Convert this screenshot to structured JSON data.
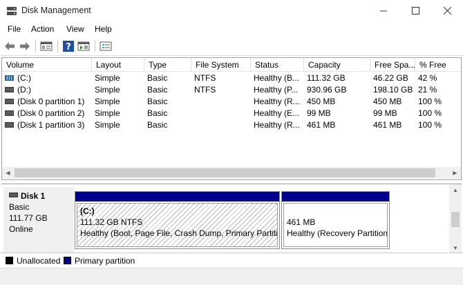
{
  "window": {
    "title": "Disk Management",
    "controls": {
      "minimize": "—",
      "maximize": "☐",
      "close": "✕"
    }
  },
  "menu": [
    "File",
    "Action",
    "View",
    "Help"
  ],
  "toolbar": {
    "buttons": [
      "back-arrow-icon",
      "forward-arrow-icon",
      "properties-icon",
      "help-icon",
      "console-icon",
      "volume-list-icon"
    ]
  },
  "volume_table": {
    "columns": [
      "Volume",
      "Layout",
      "Type",
      "File System",
      "Status",
      "Capacity",
      "Free Spa...",
      "% Free"
    ],
    "rows": [
      {
        "volume": "(C:)",
        "layout": "Simple",
        "type": "Basic",
        "fs": "NTFS",
        "status": "Healthy (B...",
        "capacity": "111.32 GB",
        "free": "46.22 GB",
        "pct": "42 %",
        "icon": "striped"
      },
      {
        "volume": "(D:)",
        "layout": "Simple",
        "type": "Basic",
        "fs": "NTFS",
        "status": "Healthy (P...",
        "capacity": "930.96 GB",
        "free": "198.10 GB",
        "pct": "21 %",
        "icon": "solid"
      },
      {
        "volume": "(Disk 0 partition 1)",
        "layout": "Simple",
        "type": "Basic",
        "fs": "",
        "status": "Healthy (R...",
        "capacity": "450 MB",
        "free": "450 MB",
        "pct": "100 %",
        "icon": "solid"
      },
      {
        "volume": "(Disk 0 partition 2)",
        "layout": "Simple",
        "type": "Basic",
        "fs": "",
        "status": "Healthy (E...",
        "capacity": "99 MB",
        "free": "99 MB",
        "pct": "100 %",
        "icon": "solid"
      },
      {
        "volume": "(Disk 1 partition 3)",
        "layout": "Simple",
        "type": "Basic",
        "fs": "",
        "status": "Healthy (R...",
        "capacity": "461 MB",
        "free": "461 MB",
        "pct": "100 %",
        "icon": "solid"
      }
    ]
  },
  "disk": {
    "name": "Disk 1",
    "type": "Basic",
    "size": "111.77 GB",
    "state": "Online",
    "partitions": [
      {
        "name": "(C:)",
        "size_fs": "111.32 GB NTFS",
        "status": "Healthy (Boot, Page File, Crash Dump, Primary Partitio"
      },
      {
        "name": "",
        "size_fs": "461 MB",
        "status": "Healthy (Recovery Partition"
      }
    ]
  },
  "legend": [
    {
      "label": "Unallocated",
      "color": "#000000"
    },
    {
      "label": "Primary partition",
      "color": "#00008b"
    }
  ]
}
